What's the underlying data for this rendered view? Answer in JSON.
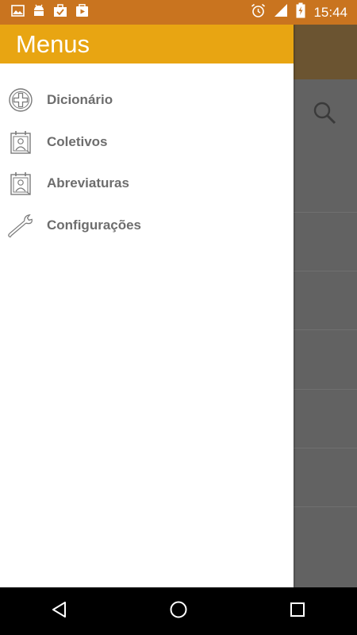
{
  "status_bar": {
    "time": "15:44",
    "left_icons": [
      "image-icon",
      "android-icon",
      "briefcase-check-icon",
      "play-store-icon"
    ],
    "right_icons": [
      "alarm-icon",
      "signal-icon",
      "battery-charging-icon"
    ],
    "background": "#c9741f"
  },
  "drawer": {
    "title": "Menus",
    "header_color": "#e8a512",
    "items": [
      {
        "label": "Dicionário",
        "icon": "plus-circle-icon"
      },
      {
        "label": "Coletivos",
        "icon": "calendar-person-icon"
      },
      {
        "label": "Abreviaturas",
        "icon": "calendar-person-icon"
      },
      {
        "label": "Configurações",
        "icon": "wrench-icon"
      }
    ]
  },
  "background_app": {
    "search_icon": "search-icon"
  },
  "nav_bar": {
    "buttons": [
      "back-icon",
      "home-icon",
      "recents-icon"
    ]
  }
}
